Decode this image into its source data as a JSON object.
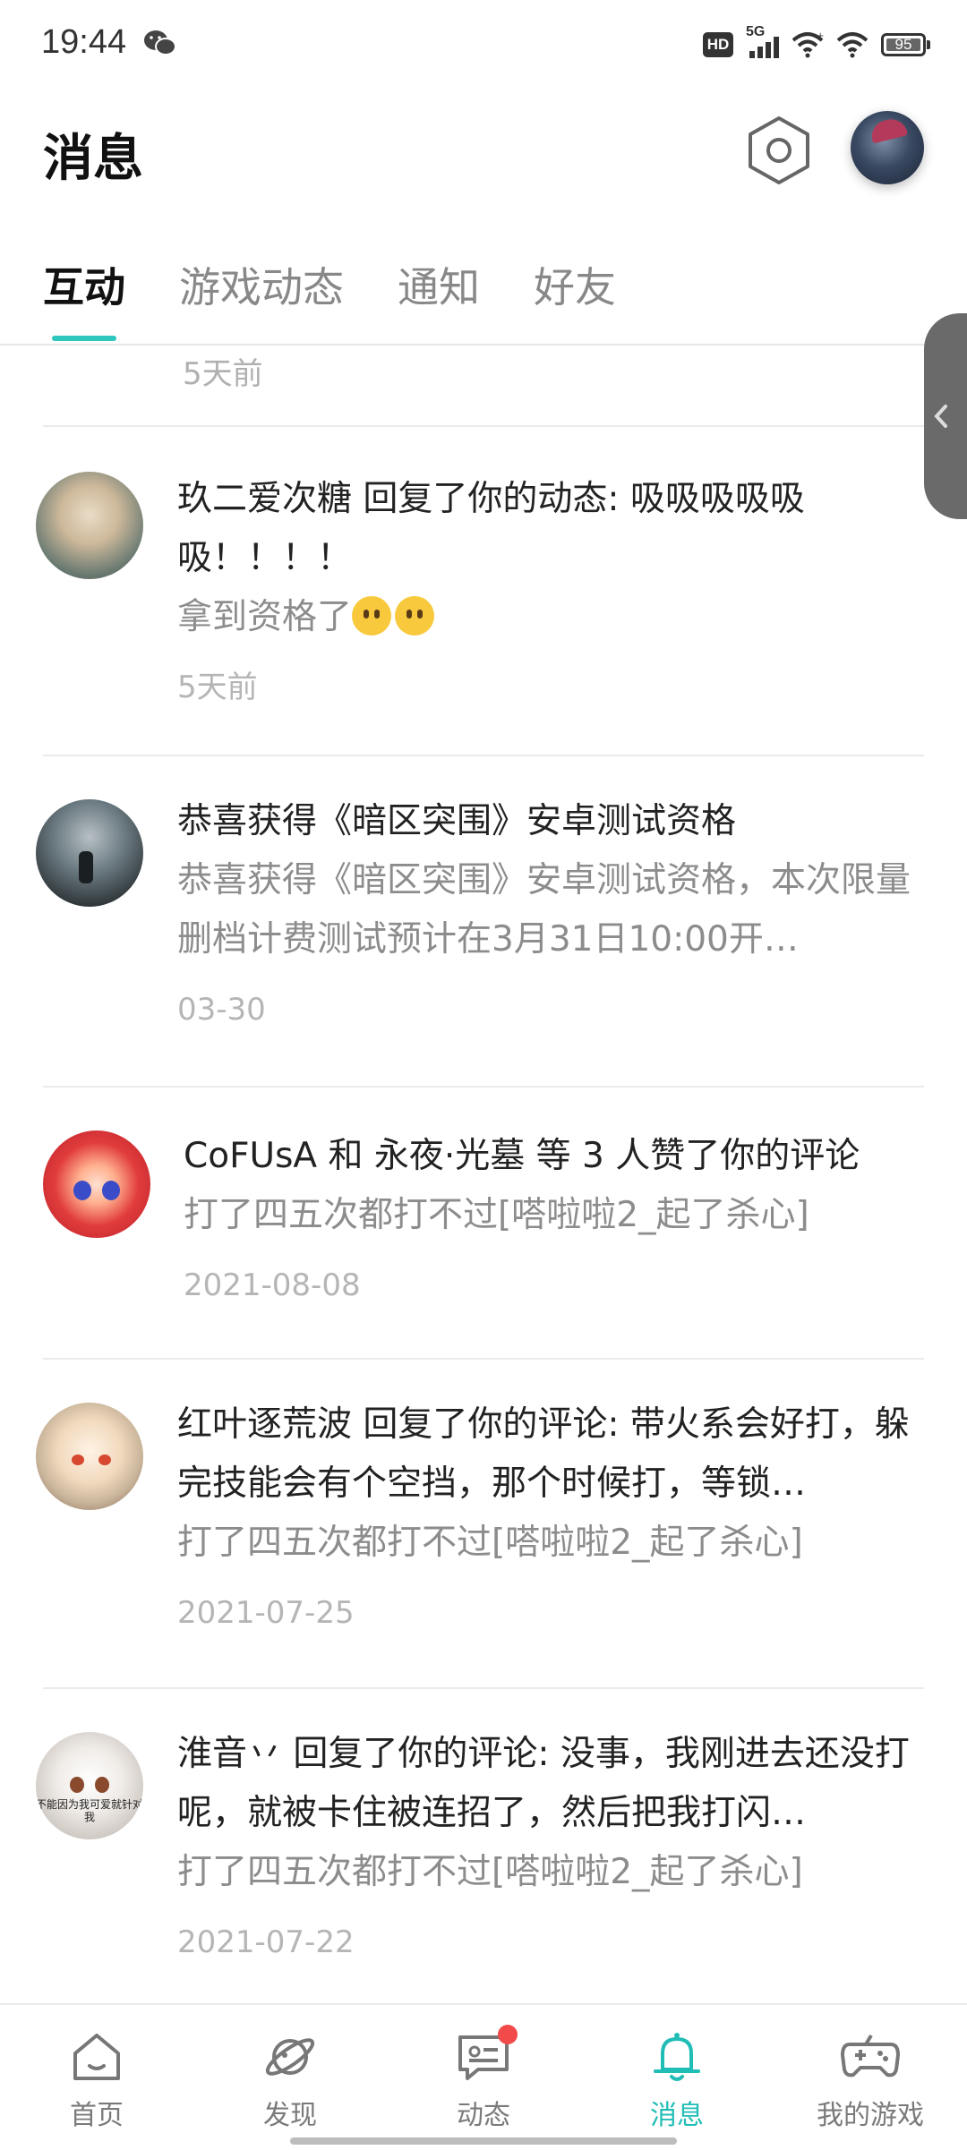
{
  "status_bar": {
    "time": "19:44",
    "network": "5G",
    "hd": "HD",
    "battery": "95",
    "icons": [
      "wechat-icon",
      "hd-icon",
      "signal-icon",
      "wifi-icon",
      "wifi-icon",
      "battery-icon"
    ]
  },
  "header": {
    "title": "消息",
    "settings_icon": "settings-hexagon-icon"
  },
  "tabs": [
    {
      "label": "互动",
      "active": true
    },
    {
      "label": "游戏动态",
      "active": false
    },
    {
      "label": "通知",
      "active": false
    },
    {
      "label": "好友",
      "active": false
    }
  ],
  "feed": {
    "top_time": "5天前",
    "items": [
      {
        "title": "玖二爱次糖 回复了你的动态: 吸吸吸吸吸吸！！！！",
        "sub_text": "拿到资格了",
        "emoji": [
          "neutral-face-emoji",
          "neutral-face-emoji"
        ],
        "time": "5天前"
      },
      {
        "title": "恭喜获得《暗区突围》安卓测试资格",
        "sub": "恭喜获得《暗区突围》安卓测试资格，本次限量删档计费测试预计在3月31日10:00开…",
        "time": "03-30"
      },
      {
        "title": "CoFUsA 和 永夜·光墓 等 3 人赞了你的评论",
        "sub": "打了四五次都打不过[嗒啦啦2_起了杀心]",
        "time": "2021-08-08"
      },
      {
        "title": "红叶逐荒波 回复了你的评论: 带火系会好打，躲完技能会有个空挡，那个时候打，等锁…",
        "sub": "打了四五次都打不过[嗒啦啦2_起了杀心]",
        "time": "2021-07-25"
      },
      {
        "title": "淮音丷 回复了你的评论: 没事，我刚进去还没打呢，就被卡住被连招了，然后把我打闪…",
        "sub": "打了四五次都打不过[嗒啦啦2_起了杀心]",
        "time": "2021-07-22",
        "avatar_caption": "不能因为我可爱就针对我"
      }
    ]
  },
  "bottom_nav": [
    {
      "label": "首页",
      "icon": "home-icon",
      "active": false
    },
    {
      "label": "发现",
      "icon": "planet-icon",
      "active": false
    },
    {
      "label": "动态",
      "icon": "chat-icon",
      "active": false,
      "has_badge": true
    },
    {
      "label": "消息",
      "icon": "bell-icon",
      "active": true
    },
    {
      "label": "我的游戏",
      "icon": "gamepad-icon",
      "active": false
    }
  ],
  "colors": {
    "accent": "#2ec7c0",
    "badge": "#f24a4a",
    "muted_text": "#8c8c8c",
    "time_text": "#b5b5b5"
  }
}
